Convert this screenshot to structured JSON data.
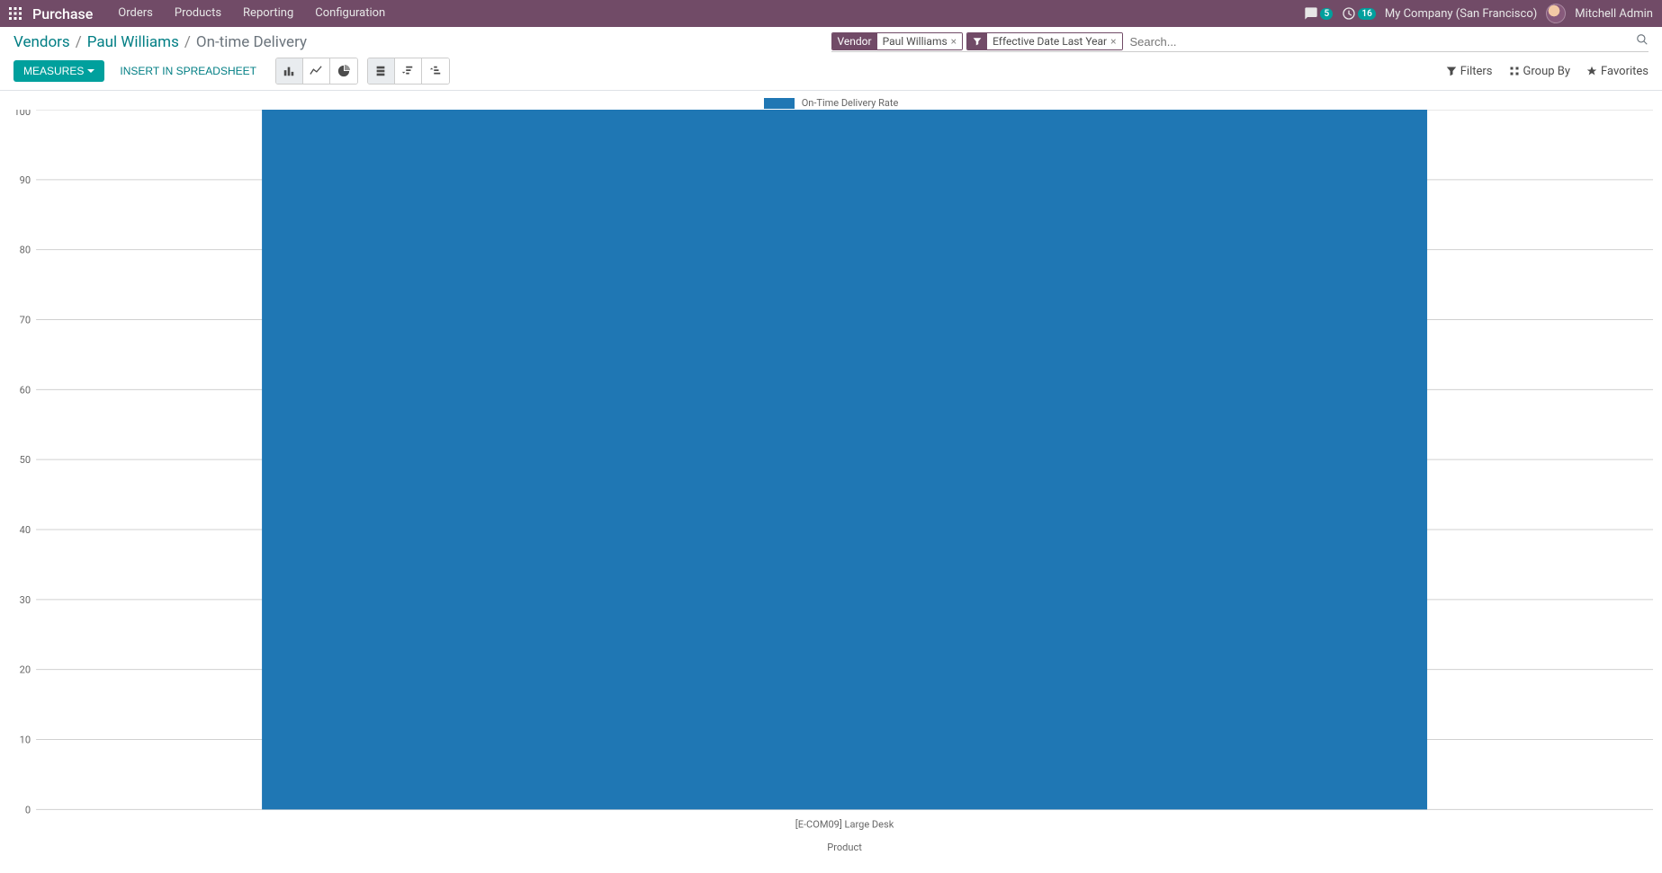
{
  "topnav": {
    "brand": "Purchase",
    "items": [
      "Orders",
      "Products",
      "Reporting",
      "Configuration"
    ],
    "messages_badge": "5",
    "activities_badge": "16",
    "company": "My Company (San Francisco)",
    "user": "Mitchell Admin"
  },
  "breadcrumb": {
    "root": "Vendors",
    "vendor": "Paul Williams",
    "page": "On-time Delivery"
  },
  "search": {
    "chip_vendor_key": "Vendor",
    "chip_vendor_val": "Paul Williams",
    "chip_filter_val": "Effective Date Last Year",
    "placeholder": "Search..."
  },
  "toolbar": {
    "measures": "Measures",
    "insert_spreadsheet": "Insert in Spreadsheet",
    "filters": "Filters",
    "groupby": "Group By",
    "favorites": "Favorites"
  },
  "legend": {
    "series1": "On-Time Delivery Rate"
  },
  "axes": {
    "xlabel": "Product"
  },
  "chart_data": {
    "type": "bar",
    "title": "",
    "xlabel": "Product",
    "ylabel": "",
    "ylim": [
      0,
      100
    ],
    "yticks": [
      0,
      10,
      20,
      30,
      40,
      50,
      60,
      70,
      80,
      90,
      100
    ],
    "categories": [
      "[E-COM09] Large Desk"
    ],
    "series": [
      {
        "name": "On-Time Delivery Rate",
        "values": [
          100
        ]
      }
    ],
    "legend_position": "top",
    "grid": true,
    "bar_color": "#1f77b4"
  }
}
